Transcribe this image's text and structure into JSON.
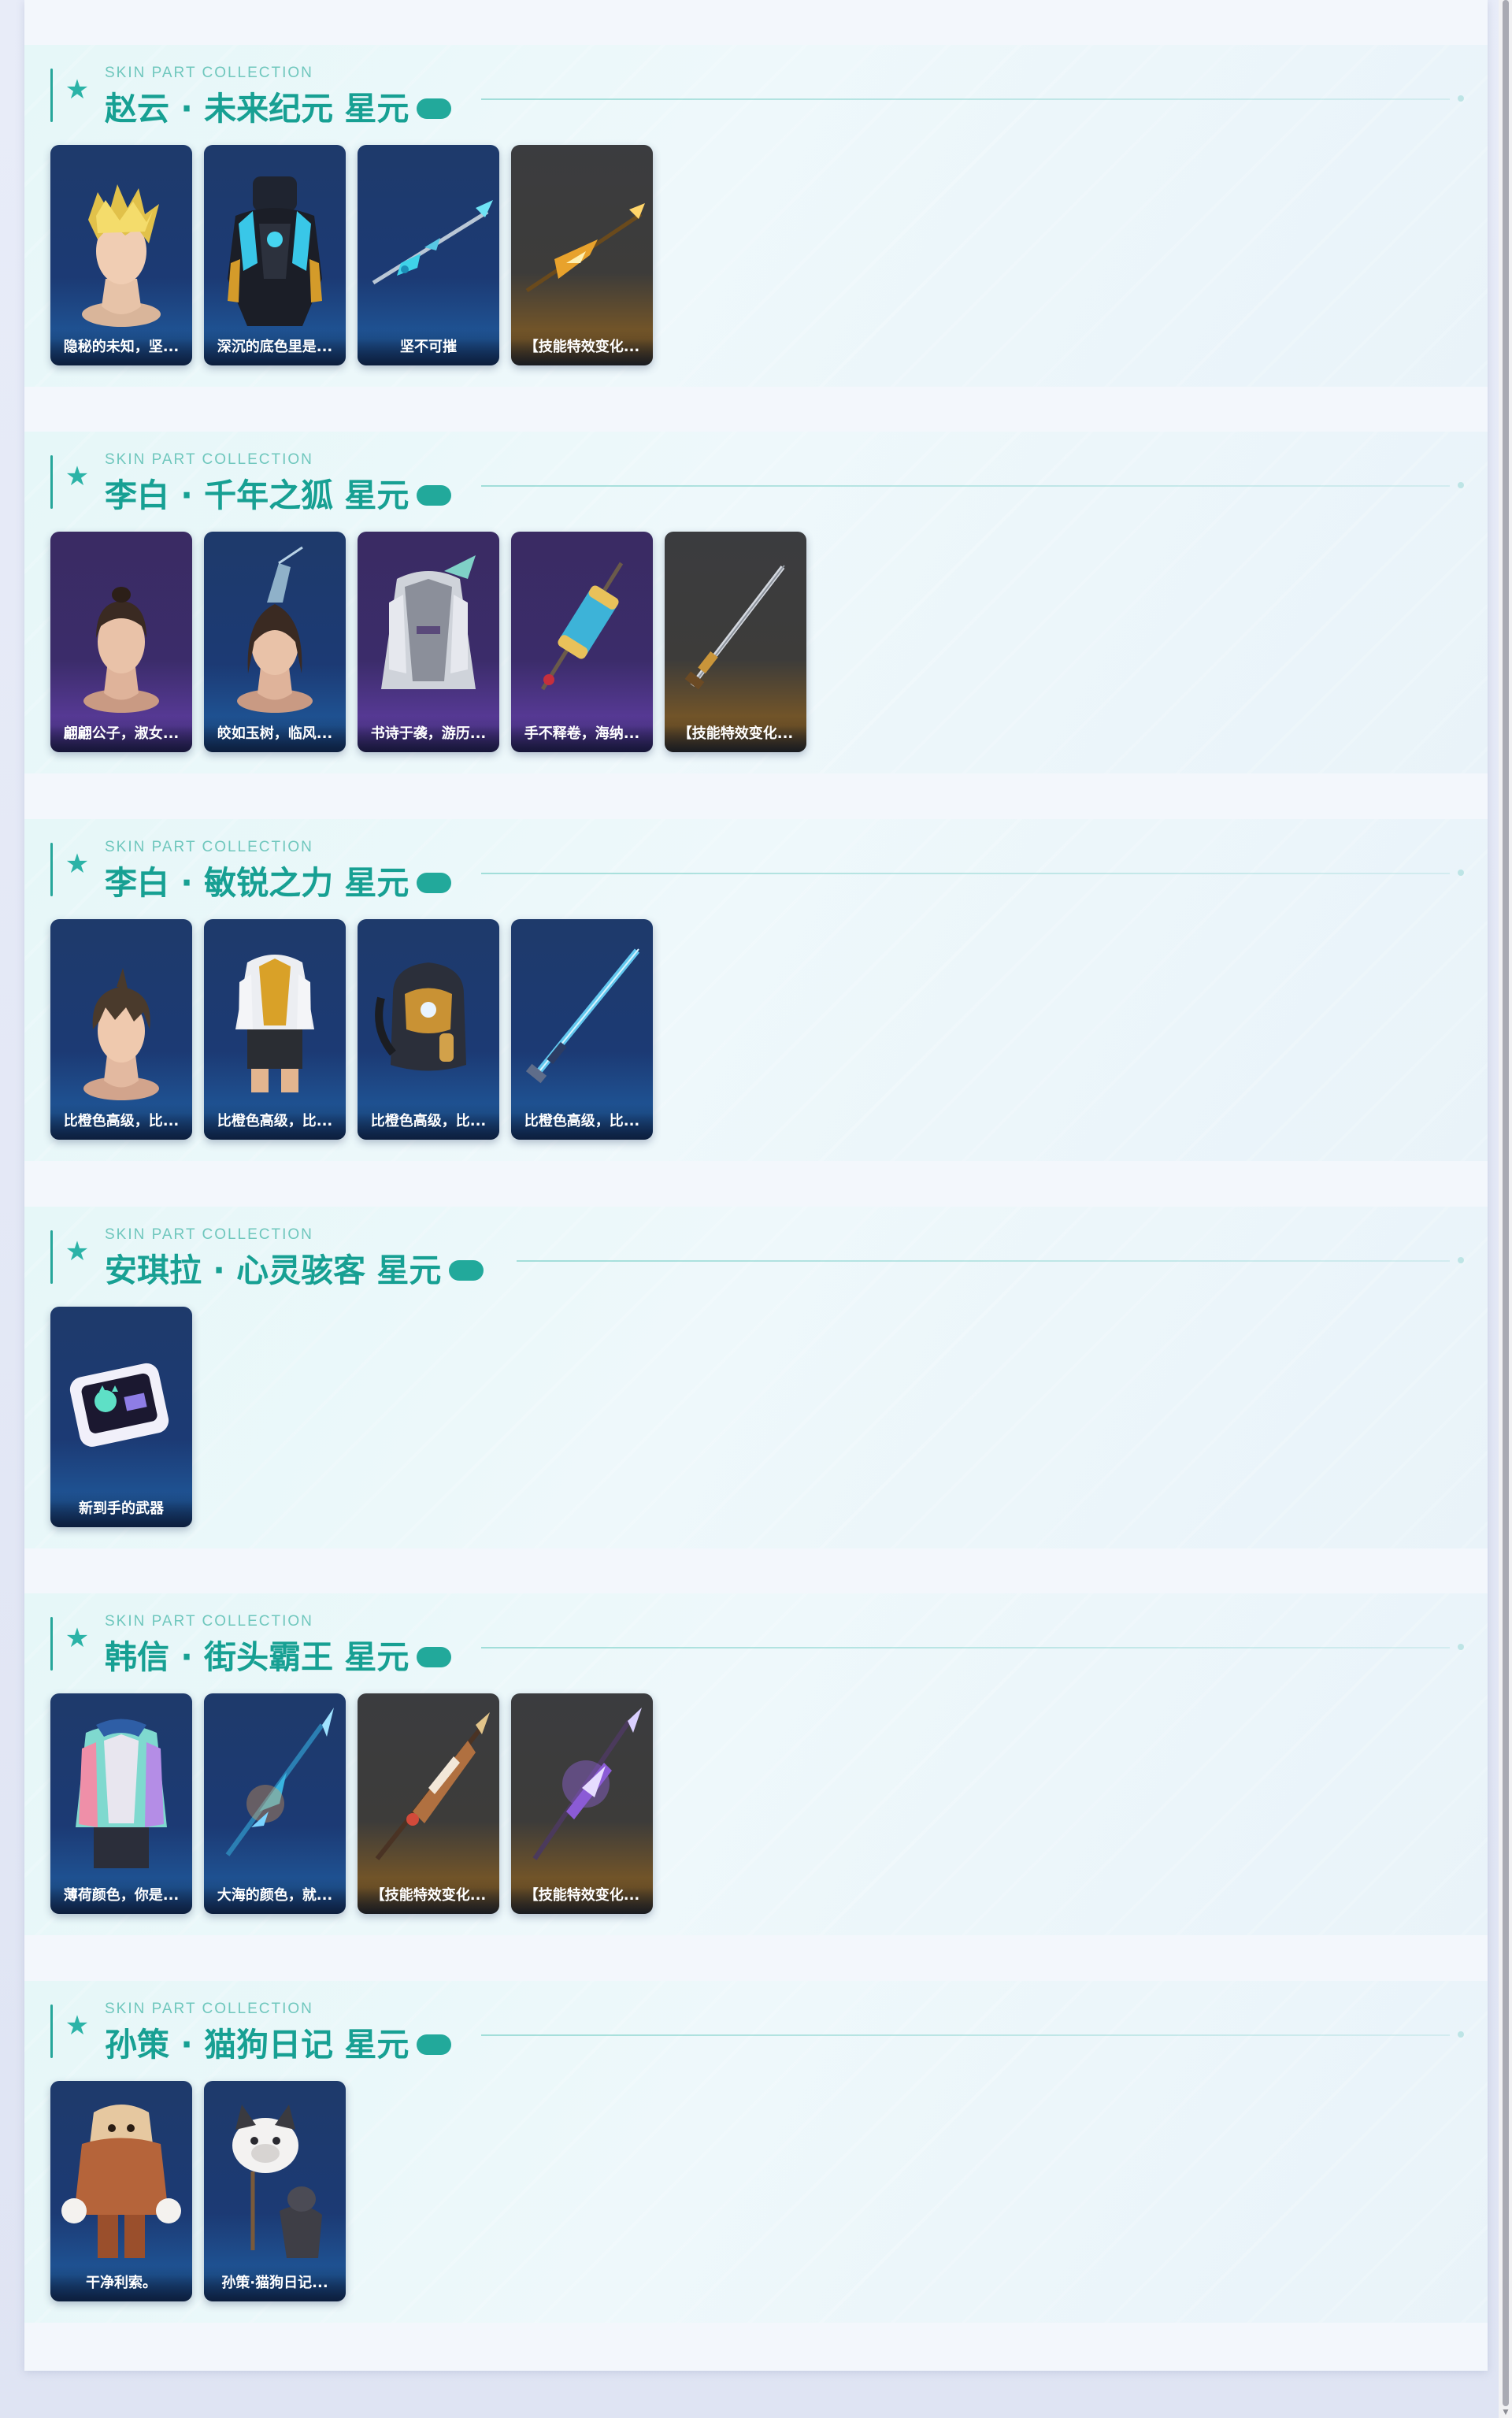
{
  "sections": [
    {
      "kicker": "SKIN PART COLLECTION",
      "title": "赵云 · 未来纪元 星元",
      "items": [
        {
          "caption": "隐秘的未知，坚...",
          "art": "golden-hair-bust",
          "bg": "blue"
        },
        {
          "caption": "深沉的底色里是...",
          "art": "armored-body",
          "bg": "blue"
        },
        {
          "caption": "坚不可摧",
          "art": "blue-spear",
          "bg": "blue"
        },
        {
          "caption": "【技能特效变化...",
          "art": "golden-spear",
          "bg": "gold"
        }
      ]
    },
    {
      "kicker": "SKIN PART COLLECTION",
      "title": "李白 · 千年之狐 星元",
      "items": [
        {
          "caption": "翩翩公子，淑女...",
          "art": "topknot-bust",
          "bg": "purple"
        },
        {
          "caption": "皎如玉树，临风...",
          "art": "crowned-bust",
          "bg": "blue"
        },
        {
          "caption": "书诗于袭，游历...",
          "art": "robed-body",
          "bg": "purple"
        },
        {
          "caption": "手不释卷，海纳...",
          "art": "scroll-weapon",
          "bg": "purple"
        },
        {
          "caption": "【技能特效变化...",
          "art": "silver-sword",
          "bg": "gold"
        }
      ]
    },
    {
      "kicker": "SKIN PART COLLECTION",
      "title": "李白 · 敏锐之力 星元",
      "items": [
        {
          "caption": "比橙色高级，比...",
          "art": "brown-hair-bust",
          "bg": "blue"
        },
        {
          "caption": "比橙色高级，比...",
          "art": "hoodie-body",
          "bg": "blue"
        },
        {
          "caption": "比橙色高级，比...",
          "art": "backpack",
          "bg": "blue"
        },
        {
          "caption": "比橙色高级，比...",
          "art": "blue-sword",
          "bg": "blue"
        }
      ]
    },
    {
      "kicker": "SKIN PART COLLECTION",
      "title": "安琪拉 · 心灵骇客 星元",
      "items": [
        {
          "caption": "新到手的武器",
          "art": "handheld-console",
          "bg": "blue"
        }
      ]
    },
    {
      "kicker": "SKIN PART COLLECTION",
      "title": "韩信 · 街头霸王 星元",
      "items": [
        {
          "caption": "薄荷颜色，你是...",
          "art": "mint-jacket-body",
          "bg": "blue"
        },
        {
          "caption": "大海的颜色，就...",
          "art": "blue-spear-2",
          "bg": "blue"
        },
        {
          "caption": "【技能特效变化...",
          "art": "graffiti-spear",
          "bg": "gold"
        },
        {
          "caption": "【技能特效变化...",
          "art": "purple-spear",
          "bg": "gold"
        }
      ]
    },
    {
      "kicker": "SKIN PART COLLECTION",
      "title": "孙策 · 猫狗日记 星元",
      "items": [
        {
          "caption": "干净利索。",
          "art": "brown-outfit-body",
          "bg": "blue"
        },
        {
          "caption": "孙策·猫狗日记...",
          "art": "dog-companion",
          "bg": "blue"
        }
      ]
    }
  ],
  "colors": {
    "accent": "#26a69a",
    "title": "#17a093",
    "card_blue": "#1c3a74",
    "card_purple": "#3b2c6a",
    "card_gold": "#7a5826"
  }
}
